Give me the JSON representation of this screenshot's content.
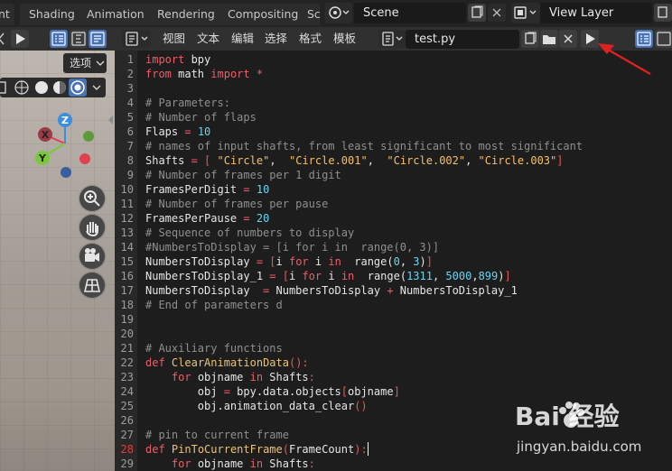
{
  "workspace_tabs": [
    "nt",
    "Shading",
    "Animation",
    "Rendering",
    "Compositing",
    "Sc"
  ],
  "scene": {
    "value": "Scene"
  },
  "view_layer": {
    "value": "View Layer"
  },
  "viewport": {
    "options_label": "选项"
  },
  "text_editor": {
    "menu": [
      "视图",
      "文本",
      "编辑",
      "选择",
      "格式",
      "模板"
    ],
    "filename": "test.py"
  },
  "colors": {
    "keyword": "#ec5d6a",
    "comment": "#8f8f8f",
    "string": "#f6c064",
    "number": "#6ad3f0",
    "function": "#e9c37a",
    "accent": "#4772b3",
    "arrow": "#e02020"
  },
  "icons": [
    "play-icon",
    "line-numbers-icon",
    "word-wrap-icon",
    "syntax-icon",
    "new-text-icon",
    "open-folder-icon",
    "close-icon",
    "zoom-icon",
    "hand-icon",
    "camera-icon",
    "grid-icon"
  ],
  "code": {
    "current_line": 28,
    "lines": [
      {
        "n": "1",
        "t": [
          [
            "kw",
            "import"
          ],
          [
            "cs",
            " bpy"
          ]
        ]
      },
      {
        "n": "2",
        "t": [
          [
            "kw",
            "from"
          ],
          [
            "cs",
            " math "
          ],
          [
            "kw",
            "import"
          ],
          [
            "cs",
            " "
          ],
          [
            "kw",
            "*"
          ]
        ]
      },
      {
        "n": "3",
        "t": []
      },
      {
        "n": "4",
        "t": [
          [
            "cm",
            "# Parameters:"
          ]
        ]
      },
      {
        "n": "5",
        "t": [
          [
            "cm",
            "# Number of flaps"
          ]
        ]
      },
      {
        "n": "6",
        "t": [
          [
            "cs",
            "Flaps "
          ],
          [
            "kw",
            "="
          ],
          [
            "cs",
            " "
          ],
          [
            "num",
            "10"
          ]
        ]
      },
      {
        "n": "7",
        "t": [
          [
            "cm",
            "# names of input shafts, from least significant to most significant"
          ]
        ]
      },
      {
        "n": "8",
        "t": [
          [
            "cs",
            "Shafts "
          ],
          [
            "kw",
            "="
          ],
          [
            "cs",
            " "
          ],
          [
            "pu",
            "["
          ],
          [
            "cs",
            " "
          ],
          [
            "str",
            "\"Circle\""
          ],
          [
            "cs",
            ",  "
          ],
          [
            "str",
            "\"Circle.001\""
          ],
          [
            "cs",
            ",  "
          ],
          [
            "str",
            "\"Circle.002\""
          ],
          [
            "cs",
            ", "
          ],
          [
            "str",
            "\"Circle.003\""
          ],
          [
            "pu",
            "]"
          ]
        ]
      },
      {
        "n": "9",
        "t": [
          [
            "cm",
            "# Number of frames per 1 digit"
          ]
        ]
      },
      {
        "n": "10",
        "t": [
          [
            "cs",
            "FramesPerDigit "
          ],
          [
            "kw",
            "="
          ],
          [
            "cs",
            " "
          ],
          [
            "num",
            "10"
          ]
        ]
      },
      {
        "n": "11",
        "t": [
          [
            "cm",
            "# Number of frames per pause"
          ]
        ]
      },
      {
        "n": "12",
        "t": [
          [
            "cs",
            "FramesPerPause "
          ],
          [
            "kw",
            "="
          ],
          [
            "cs",
            " "
          ],
          [
            "num",
            "20"
          ]
        ]
      },
      {
        "n": "13",
        "t": [
          [
            "cm",
            "# Sequence of numbers to display"
          ]
        ]
      },
      {
        "n": "14",
        "t": [
          [
            "cm",
            "#NumbersToDisplay = [i for i in  range(0, 3)]"
          ]
        ]
      },
      {
        "n": "15",
        "t": [
          [
            "cs",
            "NumbersToDisplay "
          ],
          [
            "kw",
            "="
          ],
          [
            "cs",
            " "
          ],
          [
            "pu",
            "["
          ],
          [
            "cs",
            "i "
          ],
          [
            "kw",
            "for"
          ],
          [
            "cs",
            " i "
          ],
          [
            "kw",
            "in"
          ],
          [
            "cs",
            "  range("
          ],
          [
            "num",
            "0"
          ],
          [
            "cs",
            ", "
          ],
          [
            "num",
            "3"
          ],
          [
            "cs",
            ")"
          ],
          [
            "pu",
            "]"
          ]
        ]
      },
      {
        "n": "16",
        "t": [
          [
            "cs",
            "NumbersToDisplay_1 "
          ],
          [
            "kw",
            "="
          ],
          [
            "cs",
            " "
          ],
          [
            "pu",
            "["
          ],
          [
            "cs",
            "i "
          ],
          [
            "kw",
            "for"
          ],
          [
            "cs",
            " i "
          ],
          [
            "kw",
            "in"
          ],
          [
            "cs",
            "  range("
          ],
          [
            "num",
            "1311"
          ],
          [
            "cs",
            ", "
          ],
          [
            "num",
            "5000"
          ],
          [
            "cs",
            ","
          ],
          [
            "num",
            "899"
          ],
          [
            "cs",
            ")"
          ],
          [
            "pu",
            "]"
          ]
        ]
      },
      {
        "n": "17",
        "t": [
          [
            "cs",
            "NumbersToDisplay  "
          ],
          [
            "kw",
            "="
          ],
          [
            "cs",
            " NumbersToDisplay "
          ],
          [
            "kw",
            "+"
          ],
          [
            "cs",
            " NumbersToDisplay_1"
          ]
        ]
      },
      {
        "n": "18",
        "t": [
          [
            "cm",
            "# End of parameters d"
          ]
        ]
      },
      {
        "n": "19",
        "t": []
      },
      {
        "n": "20",
        "t": []
      },
      {
        "n": "21",
        "t": [
          [
            "cm",
            "# Auxiliary functions"
          ]
        ]
      },
      {
        "n": "22",
        "t": [
          [
            "kw",
            "def"
          ],
          [
            "cs",
            " "
          ],
          [
            "fn",
            "ClearAnimationData"
          ],
          [
            "pu",
            "():"
          ]
        ]
      },
      {
        "n": "23",
        "t": [
          [
            "cs",
            "    "
          ],
          [
            "kw",
            "for"
          ],
          [
            "cs",
            " objname "
          ],
          [
            "kw",
            "in"
          ],
          [
            "cs",
            " Shafts"
          ],
          [
            "pu",
            ":"
          ]
        ]
      },
      {
        "n": "24",
        "t": [
          [
            "cs",
            "        obj "
          ],
          [
            "kw",
            "="
          ],
          [
            "cs",
            " bpy.data.objects"
          ],
          [
            "pu",
            "["
          ],
          [
            "cs",
            "objname"
          ],
          [
            "pu",
            "]"
          ]
        ]
      },
      {
        "n": "25",
        "t": [
          [
            "cs",
            "        obj.animation_data_clear"
          ],
          [
            "pu",
            "()"
          ]
        ]
      },
      {
        "n": "26",
        "t": []
      },
      {
        "n": "27",
        "t": [
          [
            "cm",
            "# pin to current frame"
          ]
        ]
      },
      {
        "n": "28",
        "t": [
          [
            "kw",
            "def"
          ],
          [
            "cs",
            " "
          ],
          [
            "fn",
            "PinToCurrentFrame"
          ],
          [
            "pu",
            "("
          ],
          [
            "cs",
            "FrameCount"
          ],
          [
            "pu",
            "):"
          ]
        ]
      },
      {
        "n": "29",
        "t": [
          [
            "cs",
            "    "
          ],
          [
            "kw",
            "for"
          ],
          [
            "cs",
            " objname "
          ],
          [
            "kw",
            "in"
          ],
          [
            "cs",
            " Shafts"
          ],
          [
            "pu",
            ":"
          ]
        ]
      }
    ]
  },
  "watermark": {
    "brand": "Bai 经验",
    "url": "jingyan.baidu.com"
  }
}
